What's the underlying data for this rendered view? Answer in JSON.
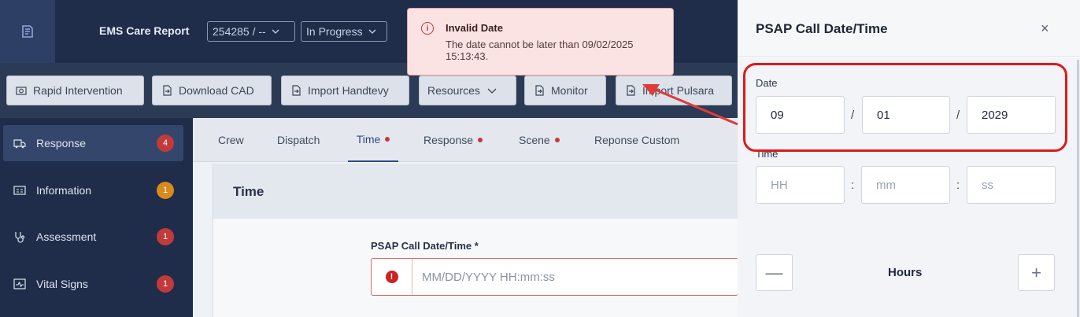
{
  "header": {
    "app_title": "EMS Care Report",
    "record_select": "254285 / --",
    "status_select": "In Progress"
  },
  "toolbar": {
    "buttons": [
      "Rapid Intervention",
      "Download CAD",
      "Import Handtevy",
      "Resources",
      "Monitor",
      "Import Pulsara"
    ]
  },
  "sidebar": {
    "items": [
      {
        "label": "Response",
        "badge": "4"
      },
      {
        "label": "Information",
        "badge": "1"
      },
      {
        "label": "Assessment",
        "badge": "1"
      },
      {
        "label": "Vital Signs",
        "badge": "1"
      }
    ]
  },
  "tabs": [
    "Crew",
    "Dispatch",
    "Time",
    "Response",
    "Scene",
    "Reponse Custom"
  ],
  "panel": {
    "title": "Time",
    "field_label": "PSAP Call Date/Time  *",
    "field_placeholder": "MM/DD/YYYY HH:mm:ss"
  },
  "toast": {
    "title": "Invalid Date",
    "message": "The date cannot be later than 09/02/2025 15:13:43."
  },
  "right_panel": {
    "title": "PSAP Call Date/Time",
    "close": "×",
    "date_label": "Date",
    "month": "09",
    "day": "01",
    "year": "2029",
    "date_sep": "/",
    "time_label": "Time",
    "hh_placeholder": "HH",
    "mm_placeholder": "mm",
    "ss_placeholder": "ss",
    "time_sep": ":",
    "hours_label": "Hours",
    "minus": "—",
    "plus": "+"
  },
  "colors": {
    "accent": "#2f4a86",
    "error": "#dd1a1a",
    "badge_red": "#c23a3a",
    "badge_orange": "#d98a1e"
  }
}
